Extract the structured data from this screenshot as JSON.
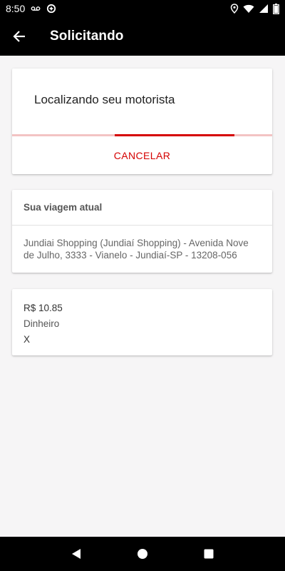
{
  "status_bar": {
    "time": "8:50",
    "icons": [
      "voicemail-icon",
      "data-saver-icon",
      "location-icon",
      "wifi-icon",
      "signal-icon",
      "battery-icon"
    ]
  },
  "app_bar": {
    "title": "Solicitando",
    "back_icon": "arrow-back-icon"
  },
  "searching_card": {
    "text": "Localizando seu motorista",
    "cancel_label": "CANCELAR",
    "accent_color": "#d50000",
    "track_color": "#f3c3c3"
  },
  "trip_card": {
    "header": "Sua viagem atual",
    "address": "Jundiai Shopping (Jundiaí Shopping) - Avenida Nove de Julho, 3333 - Vianelo - Jundiaí-SP - 13208-056"
  },
  "payment_card": {
    "price": "R$ 10.85",
    "method": "Dinheiro",
    "extra": "X"
  },
  "nav_bar": {
    "icons": [
      "back-triangle-icon",
      "home-circle-icon",
      "recents-square-icon"
    ]
  }
}
